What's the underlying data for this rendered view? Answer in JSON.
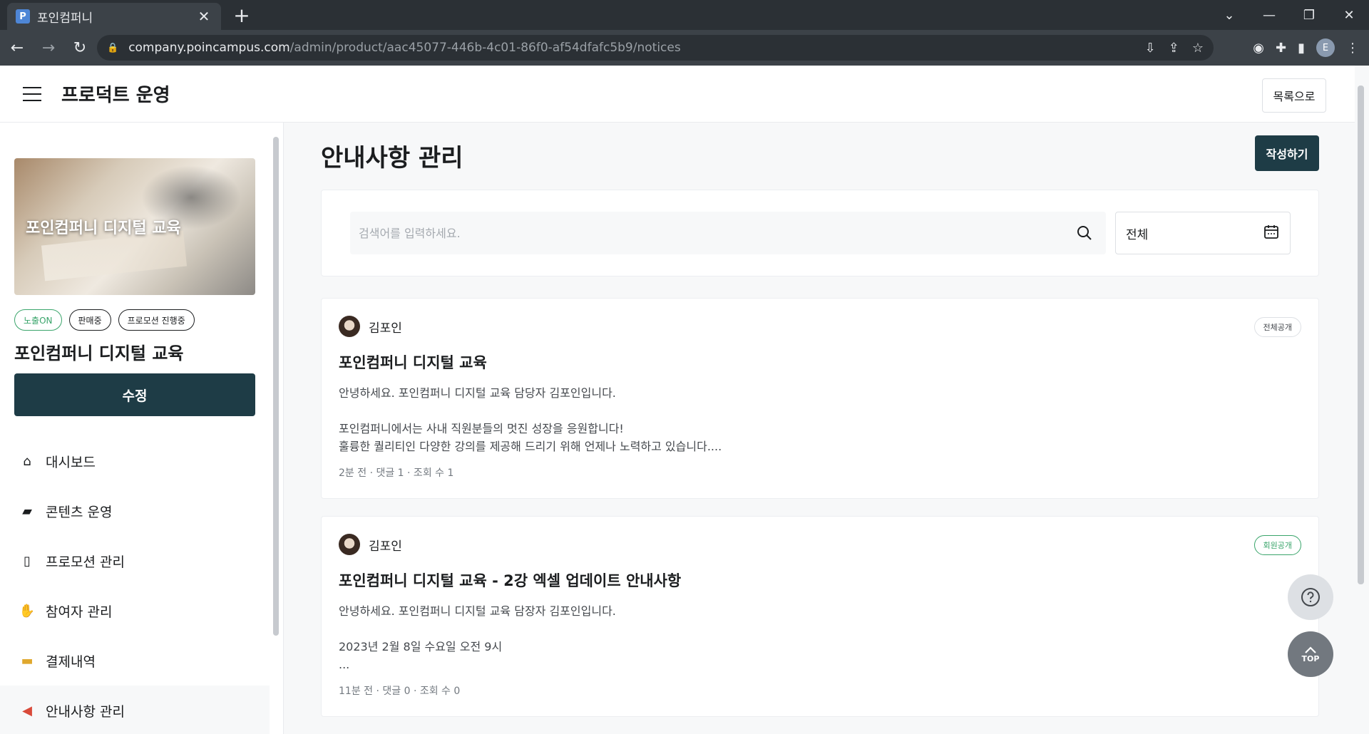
{
  "browser": {
    "tab_title": "포인컴퍼니",
    "favicon_letter": "P",
    "url_host": "company.poincampus.com",
    "url_path": "/admin/product/aac45077-446b-4c01-86f0-af54dfafc5b9/notices",
    "profile_initial": "E"
  },
  "header": {
    "title": "프로덕트 운영",
    "back_label": "목록으로"
  },
  "sidebar": {
    "thumbnail_label": "포인컴퍼니 디지털 교육",
    "badges": [
      "노출ON",
      "판매중",
      "프로모션 진행중"
    ],
    "product_name": "포인컴퍼니 디지털 교육",
    "edit_label": "수정",
    "menu": [
      {
        "label": "대시보드",
        "icon": "house-icon"
      },
      {
        "label": "콘텐츠 운영",
        "icon": "folder-icon"
      },
      {
        "label": "프로모션 관리",
        "icon": "calendar-icon"
      },
      {
        "label": "참여자 관리",
        "icon": "hand-icon"
      },
      {
        "label": "결제내역",
        "icon": "card-icon"
      },
      {
        "label": "안내사항 관리",
        "icon": "megaphone-icon"
      }
    ]
  },
  "main": {
    "title": "안내사항 관리",
    "write_label": "작성하기",
    "search_placeholder": "검색어를 입력하세요.",
    "filter_value": "전체",
    "notices": [
      {
        "author": "김포인",
        "visibility": "전체공개",
        "title": "포인컴퍼니 디지털 교육",
        "body": "안녕하세요. 포인컴퍼니 디지털 교육 담당자 김포인입니다.\n\n포인컴퍼니에서는 사내 직원분들의 멋진 성장을 응원합니다!\n훌륭한 퀄리티인 다양한 강의를 제공해 드리기 위해 언제나 노력하고 있습니다....",
        "meta": "2분 전 · 댓글 1 · 조회 수 1"
      },
      {
        "author": "김포인",
        "visibility": "회원공개",
        "title": "포인컴퍼니 디지털 교육 - 2강 엑셀 업데이트 안내사항",
        "body": "안녕하세요. 포인컴퍼니 디지털 교육 담장자 김포인입니다.\n\n2023년 2월 8일 수요일 오전 9시\n...",
        "meta": "11분 전 · 댓글 0 · 조회 수 0"
      }
    ],
    "top_label": "TOP"
  },
  "colors": {
    "primary": "#1e3c46",
    "green": "#3aa56b"
  }
}
